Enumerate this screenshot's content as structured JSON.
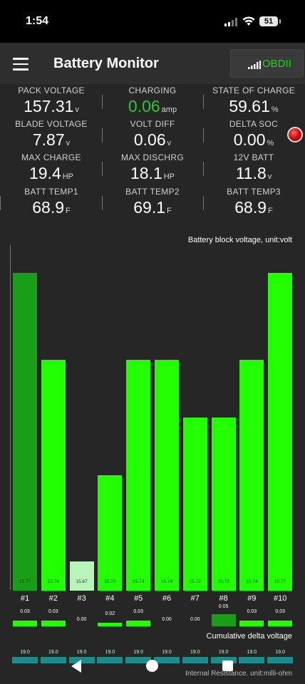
{
  "status_bar": {
    "time": "1:54",
    "battery": "51"
  },
  "app_bar": {
    "title": "Battery Monitor",
    "obd_label": "OBDII"
  },
  "metrics": [
    {
      "label": "PACK VOLTAGE",
      "value": "157.31",
      "unit": "v"
    },
    {
      "label": "CHARGING",
      "value": "0.06",
      "unit": "amp",
      "color": "#2fc72f"
    },
    {
      "label": "STATE OF CHARGE",
      "value": "59.61",
      "unit": "%"
    },
    {
      "label": "BLADE VOLTAGE",
      "value": "7.87",
      "unit": "v"
    },
    {
      "label": "VOLT DIFF",
      "value": "0.06",
      "unit": "v"
    },
    {
      "label": "DELTA SOC",
      "value": "0.00",
      "unit": "%"
    },
    {
      "label": "MAX CHARGE",
      "value": "19.4",
      "unit": "HP"
    },
    {
      "label": "MAX DISCHRG",
      "value": "18.1",
      "unit": "HP"
    },
    {
      "label": "12V BATT",
      "value": "11.8",
      "unit": "v"
    },
    {
      "label": "BATT TEMP1",
      "value": "68.9",
      "unit": "F"
    },
    {
      "label": "BATT TEMP2",
      "value": "69.1",
      "unit": "F"
    },
    {
      "label": "BATT TEMP3",
      "value": "68.9",
      "unit": "F"
    }
  ],
  "chart_data": {
    "type": "bar",
    "title": "Battery block voltage, unit:volt",
    "categories": [
      "#1",
      "#2",
      "#3",
      "#4",
      "#5",
      "#6",
      "#7",
      "#8",
      "#9",
      "#10"
    ],
    "values": [
      15.77,
      15.74,
      15.67,
      15.7,
      15.74,
      15.74,
      15.72,
      15.72,
      15.74,
      15.77
    ],
    "colors": [
      "#1a9e1a",
      "#21ff00",
      "#b8f5b8",
      "#21ff00",
      "#21ff00",
      "#21ff00",
      "#21ff00",
      "#21ff00",
      "#21ff00",
      "#21ff00"
    ],
    "value_labels": [
      "15.77",
      "15.74",
      "15.67",
      "15.70",
      "15.74",
      "15.74",
      "15.72",
      "15.72",
      "15.74",
      "15.77"
    ],
    "ylim": [
      15.66,
      15.77
    ],
    "delta": {
      "title": "Cumulative delta voltage",
      "values": [
        0.03,
        0.03,
        0.0,
        0.02,
        0.03,
        0.0,
        0.0,
        0.05,
        0.03,
        0.03
      ],
      "labels": [
        "0.03",
        "0.03",
        "0.00",
        "0.02",
        "0.03",
        "0.00",
        "0.00",
        "0.05",
        "0.03",
        "0.03"
      ],
      "colors": [
        "#21ff00",
        "#21ff00",
        "#21ff00",
        "#21ff00",
        "#21ff00",
        "#21ff00",
        "#21ff00",
        "#1a9e1a",
        "#21ff00",
        "#21ff00"
      ]
    },
    "internal_resistance": {
      "title": "Internal Resistance. unit:milli-ohm",
      "labels": [
        "19.0",
        "19.0",
        "19.0",
        "19.0",
        "19.0",
        "19.0",
        "19.0",
        "19.0",
        "19.0",
        "19.0"
      ]
    }
  }
}
